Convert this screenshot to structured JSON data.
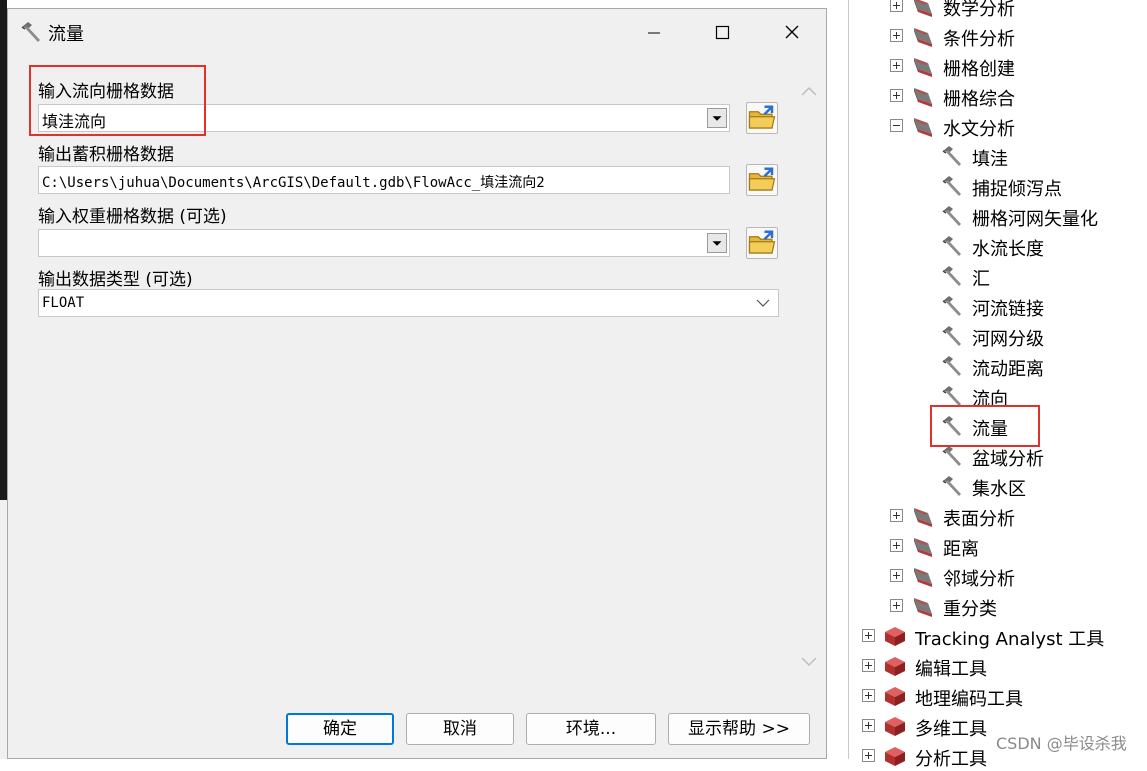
{
  "dialog": {
    "title": "流量",
    "fields": [
      {
        "label": "输入流向栅格数据",
        "value": "填洼流向"
      },
      {
        "label": "输出蓄积栅格数据",
        "value": "C:\\Users\\juhua\\Documents\\ArcGIS\\Default.gdb\\FlowAcc_填洼流向2"
      },
      {
        "label": "输入权重栅格数据 (可选)",
        "value": ""
      },
      {
        "label": "输出数据类型 (可选)",
        "value": "FLOAT"
      }
    ],
    "buttons": {
      "ok": "确定",
      "cancel": "取消",
      "env": "环境...",
      "help": "显示帮助 >>"
    }
  },
  "tree": {
    "toolsets": [
      "数学分析",
      "条件分析",
      "栅格创建",
      "栅格综合",
      "水文分析"
    ],
    "hydrology_tools": [
      "填洼",
      "捕捉倾泻点",
      "栅格河网矢量化",
      "水流长度",
      "汇",
      "河流链接",
      "河网分级",
      "流动距离",
      "流向",
      "流量",
      "盆域分析",
      "集水区"
    ],
    "toolsets_after": [
      "表面分析",
      "距离",
      "邻域分析",
      "重分类"
    ],
    "toolboxes": [
      "Tracking Analyst 工具",
      "编辑工具",
      "地理编码工具",
      "多维工具",
      "分析工具"
    ]
  },
  "watermark": "CSDN @毕设杀我",
  "colors": {
    "highlight": "#e0312b",
    "accent": "#0078d7"
  }
}
